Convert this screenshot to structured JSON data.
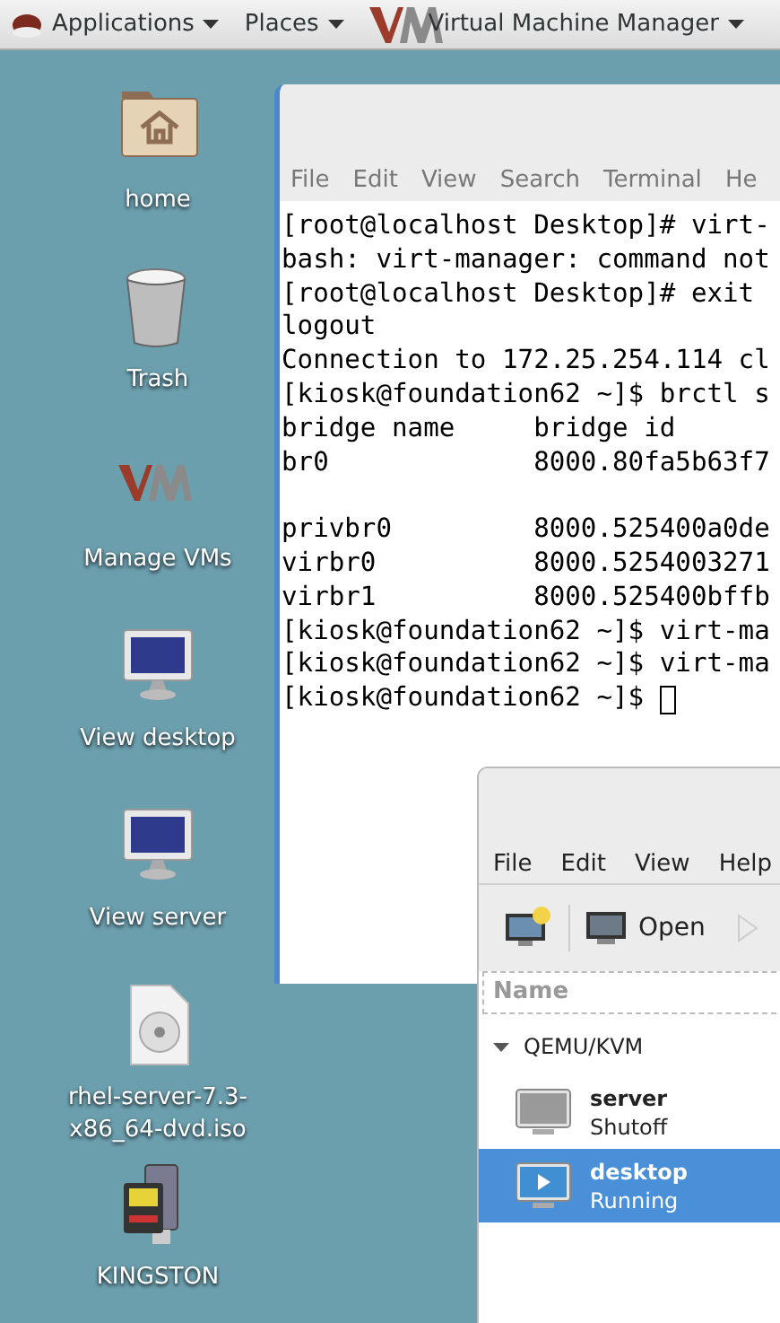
{
  "top_bar": {
    "menus": [
      {
        "label": "Applications",
        "kind": "os"
      },
      {
        "label": "Places",
        "kind": "plain"
      },
      {
        "label": "Virtual Machine Manager",
        "kind": "vm"
      }
    ]
  },
  "desktop_icons": [
    {
      "label": "home",
      "kind": "home"
    },
    {
      "label": "Trash",
      "kind": "trash"
    },
    {
      "label": "Manage VMs",
      "kind": "vm"
    },
    {
      "label": "View desktop",
      "kind": "monitor"
    },
    {
      "label": "View server",
      "kind": "monitor"
    },
    {
      "label": "rhel-server-7.3-x86_64-dvd.iso",
      "kind": "disc"
    },
    {
      "label": "KINGSTON",
      "kind": "usb"
    }
  ],
  "terminal": {
    "menu": [
      "File",
      "Edit",
      "View",
      "Search",
      "Terminal",
      "He"
    ],
    "blocks": [
      [
        "[root@localhost Desktop]# virt-",
        "bash: virt-manager: command not",
        "[root@localhost Desktop]# exit",
        "logout",
        "Connection to 172.25.254.114 cl",
        "[kiosk@foundation62 ~]$ brctl s",
        "bridge name     bridge id",
        "br0             8000.80fa5b63f7"
      ],
      [
        "privbr0         8000.525400a0de",
        "virbr0          8000.5254003271",
        "virbr1          8000.525400bffb",
        "[kiosk@foundation62 ~]$ virt-ma",
        "[kiosk@foundation62 ~]$ virt-ma",
        "[kiosk@foundation62 ~]$ "
      ]
    ]
  },
  "vm_manager": {
    "menu": [
      "File",
      "Edit",
      "View",
      "Help"
    ],
    "open_button": "Open",
    "column": "Name",
    "connection": {
      "label": "QEMU/KVM",
      "expanded": true
    },
    "vms": [
      {
        "name": "server",
        "status": "Shutoff",
        "running": false,
        "selected": false
      },
      {
        "name": "desktop",
        "status": "Running",
        "running": true,
        "selected": true
      }
    ]
  }
}
